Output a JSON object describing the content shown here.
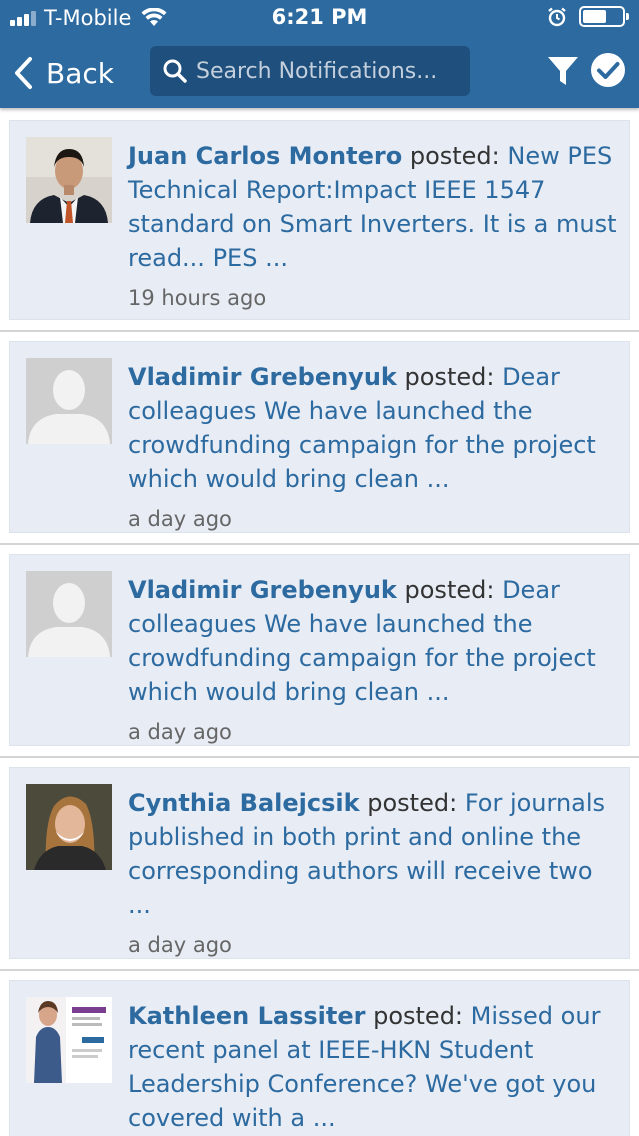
{
  "status_bar": {
    "carrier": "T-Mobile",
    "time": "6:21 PM"
  },
  "nav": {
    "back_label": "Back",
    "search_placeholder": "Search Notifications..."
  },
  "notifications": [
    {
      "author": "Juan Carlos Montero",
      "verb": "posted:",
      "excerpt": "New PES Technical Report:Impact IEEE 1547 standard on Smart Inverters. It is a must read... PES ...",
      "time": "19 hours ago",
      "avatar": "photo-man-suit"
    },
    {
      "author": "Vladimir Grebenyuk",
      "verb": "posted:",
      "excerpt": "Dear colleagues We have launched the crowdfunding campaign for the project which would bring clean ...",
      "time": "a day ago",
      "avatar": "default-silhouette"
    },
    {
      "author": "Vladimir Grebenyuk",
      "verb": "posted:",
      "excerpt": "Dear colleagues We have launched the crowdfunding campaign for the project which would bring clean ...",
      "time": "a day ago",
      "avatar": "default-silhouette"
    },
    {
      "author": "Cynthia Balejcsik",
      "verb": "posted:",
      "excerpt": "For journals published in both print and online the corresponding authors will receive two ...",
      "time": "a day ago",
      "avatar": "photo-woman-smiling"
    },
    {
      "author": "Kathleen Lassiter",
      "verb": "posted:",
      "excerpt": "Missed our recent panel at IEEE-HKN Student Leadership Conference? We've got you covered with a ...",
      "time": "",
      "avatar": "photo-woman-poster"
    }
  ],
  "colors": {
    "header": "#2c6aa0",
    "card_bg": "#e7ecf5",
    "link": "#2c6aa0"
  }
}
